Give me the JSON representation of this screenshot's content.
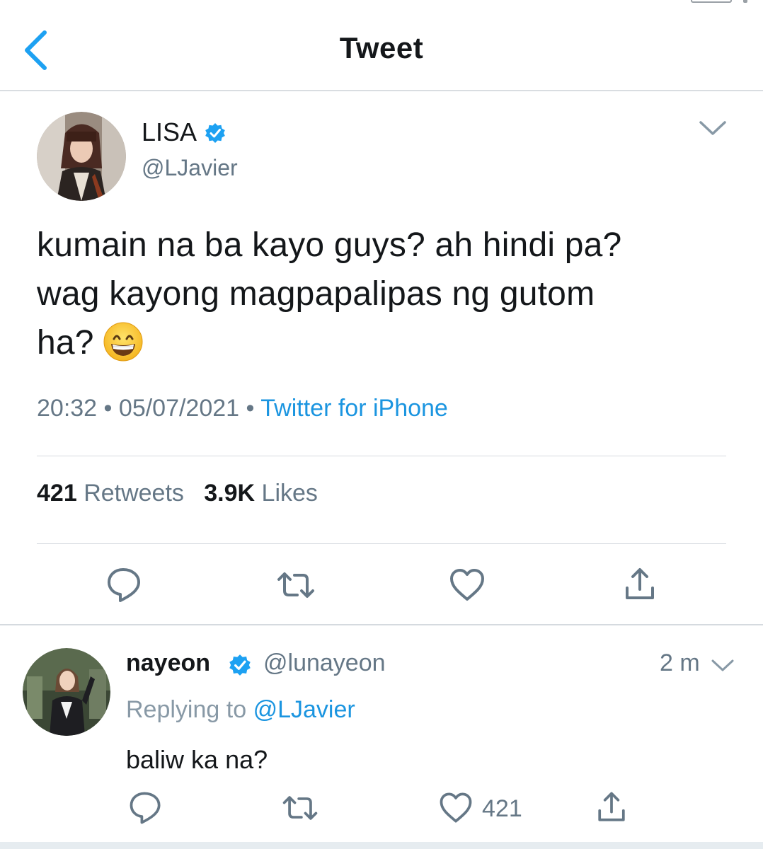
{
  "header": {
    "title": "Tweet",
    "back_icon": "chevron-left-icon"
  },
  "colors": {
    "accent": "#1da1f2",
    "secondary_text": "#657786",
    "primary_text": "#14171a"
  },
  "tweet": {
    "author_name": "LISA",
    "verified": true,
    "handle": "@LJavier",
    "text_lines": [
      "kumain na ba kayo guys? ah hindi pa?",
      "wag kayong magpapalipas ng gutom",
      "ha?"
    ],
    "emoji": "grinning-face-emoji",
    "time": "20:32",
    "date": "05/07/2021",
    "separator": "•",
    "source": "Twitter for iPhone",
    "retweet_count": "421",
    "retweets_label": "Retweets",
    "like_count": "3.9K",
    "likes_label": "Likes",
    "actions": [
      "reply-icon",
      "retweet-icon",
      "heart-icon",
      "share-icon"
    ]
  },
  "reply": {
    "author_name": "nayeon",
    "verified": true,
    "handle": "@lunayeon",
    "time_ago": "2 m",
    "replying_label": "Replying to",
    "replying_mention": "@LJavier",
    "text": "baliw ka na?",
    "like_count": "421",
    "actions": [
      "reply-icon",
      "retweet-icon",
      "heart-icon",
      "share-icon"
    ]
  }
}
